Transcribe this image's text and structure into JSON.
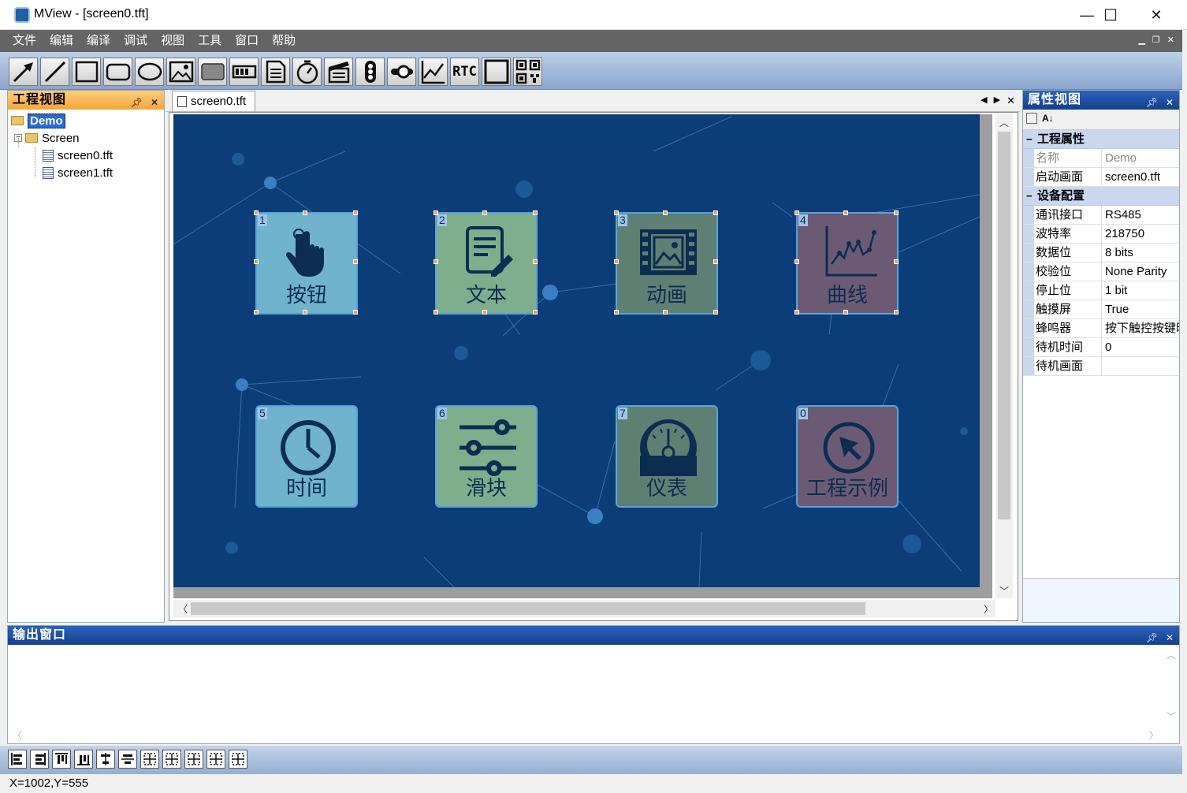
{
  "window": {
    "title": "MView - [screen0.tft]",
    "min": "—",
    "max": "☐",
    "close": "✕"
  },
  "menu": [
    "文件",
    "编辑",
    "编译",
    "调试",
    "视图",
    "工具",
    "窗口",
    "帮助"
  ],
  "toolbar_icons": [
    "pointer-tool",
    "line-tool",
    "rectangle-tool",
    "rounded-rect-tool",
    "ellipse-tool",
    "picture-tool",
    "button-tool",
    "progress-tool",
    "text-tool",
    "timer-tool",
    "animation-tool",
    "slider-tool",
    "switch-tool",
    "curve-tool",
    "rtc-tool",
    "frame-tool",
    "qrcode-tool"
  ],
  "toolbar_rtc_label": "RTC",
  "project": {
    "title": "工程视图",
    "root": "Demo",
    "folder": "Screen",
    "files": [
      "screen0.tft",
      "screen1.tft"
    ]
  },
  "doc": {
    "tab": "screen0.tft"
  },
  "widgets": [
    {
      "id": "1",
      "label": "按钮",
      "icon": "hand-pointer-icon",
      "color": "#6fb3cc"
    },
    {
      "id": "2",
      "label": "文本",
      "icon": "document-edit-icon",
      "color": "#7fae8c"
    },
    {
      "id": "3",
      "label": "动画",
      "icon": "film-image-icon",
      "color": "#5e8072"
    },
    {
      "id": "4",
      "label": "曲线",
      "icon": "line-chart-icon",
      "color": "#6c5a74"
    },
    {
      "id": "5",
      "label": "时间",
      "icon": "clock-icon",
      "color": "#6fb3cc"
    },
    {
      "id": "6",
      "label": "滑块",
      "icon": "sliders-icon",
      "color": "#7fae8c"
    },
    {
      "id": "7",
      "label": "仪表",
      "icon": "gauge-icon",
      "color": "#5e8072"
    },
    {
      "id": "0",
      "label": "工程示例",
      "icon": "arrow-circle-icon",
      "color": "#6c5a74"
    }
  ],
  "properties": {
    "title": "属性视图",
    "groups": [
      {
        "name": "工程属性",
        "rows": [
          {
            "k": "名称",
            "v": "Demo",
            "dim": true
          },
          {
            "k": "启动画面",
            "v": "screen0.tft"
          }
        ]
      },
      {
        "name": "设备配置",
        "rows": [
          {
            "k": "通讯接口",
            "v": "RS485"
          },
          {
            "k": "波特率",
            "v": "218750"
          },
          {
            "k": "数据位",
            "v": "8 bits"
          },
          {
            "k": "校验位",
            "v": "None Parity"
          },
          {
            "k": "停止位",
            "v": "1 bit"
          },
          {
            "k": "触摸屏",
            "v": "True"
          },
          {
            "k": "蜂鸣器",
            "v": "按下触控按键时"
          },
          {
            "k": "待机时间",
            "v": "0"
          },
          {
            "k": "待机画面",
            "v": ""
          }
        ]
      }
    ]
  },
  "output": {
    "title": "输出窗口"
  },
  "status": {
    "coords": "X=1002,Y=555"
  }
}
